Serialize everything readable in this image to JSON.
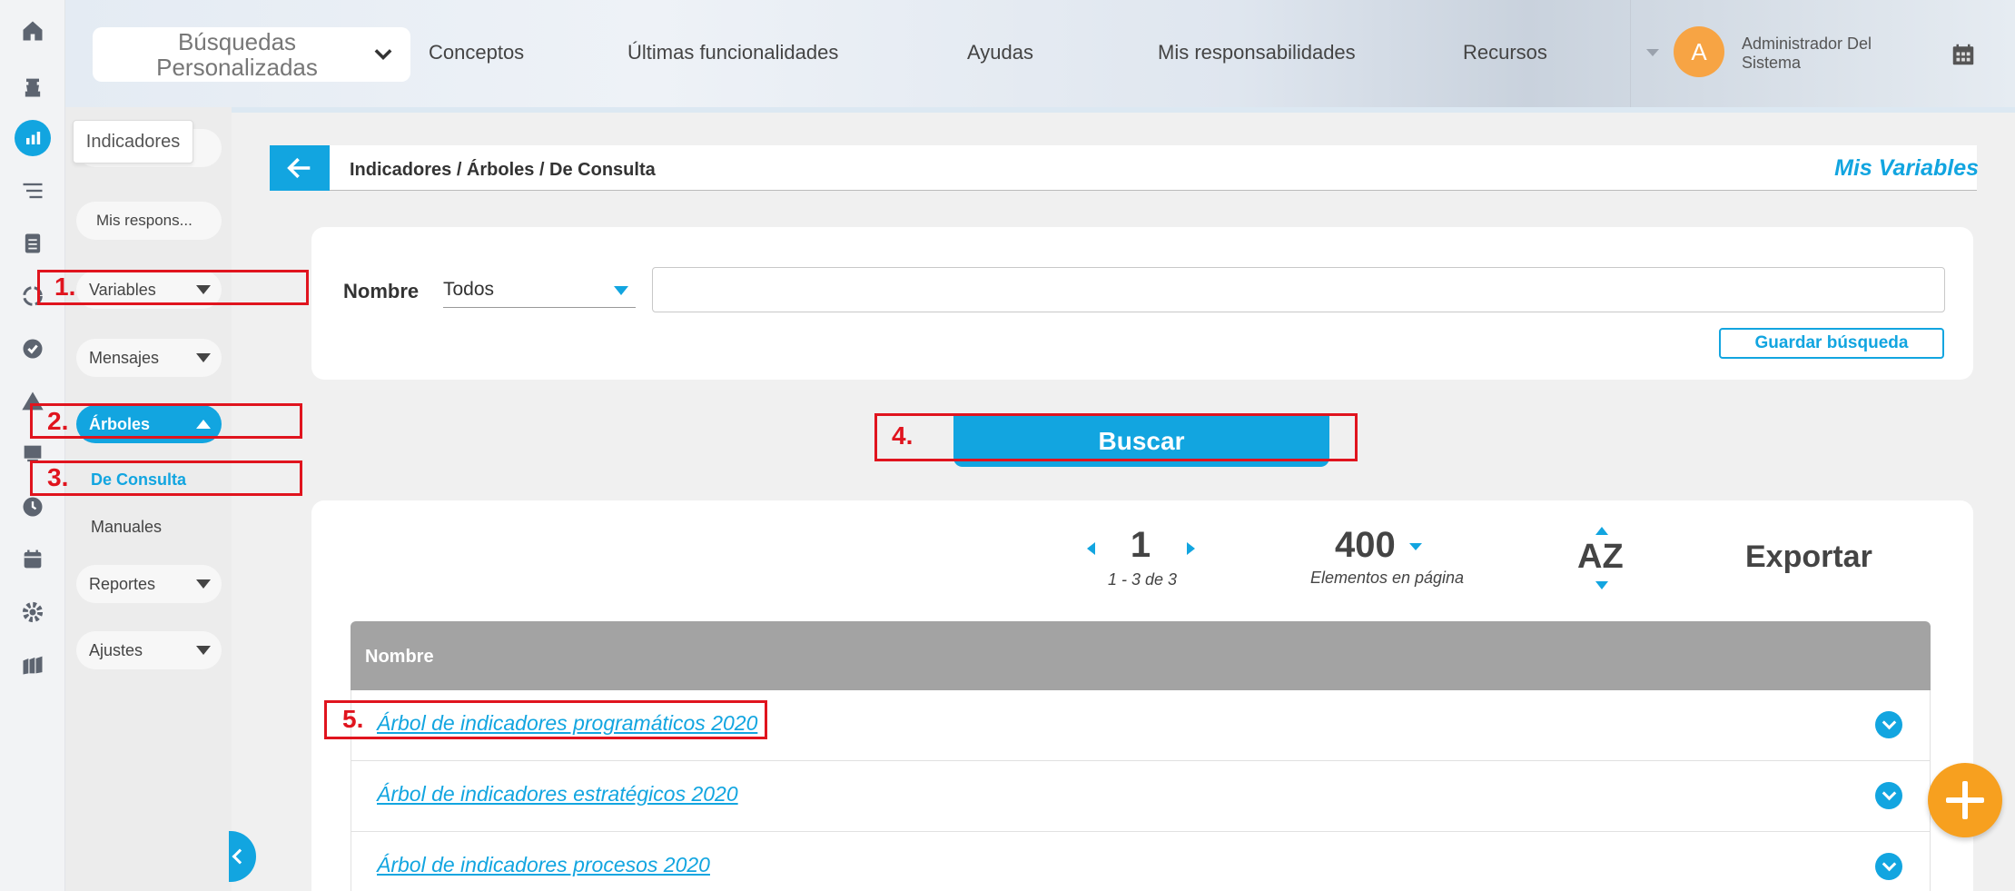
{
  "header": {
    "search_label": "Búsquedas Personalizadas",
    "nav": [
      "Conceptos",
      "Últimas funcionalidades",
      "Ayudas",
      "Mis responsabilidades",
      "Recursos"
    ],
    "user_initial": "A",
    "user_name": "Administrador Del Sistema"
  },
  "sidebar": {
    "tooltip": "Indicadores",
    "items": {
      "mis_responsabilidades": "Mis respons...",
      "variables": "Variables",
      "mensajes": "Mensajes",
      "arboles": "Árboles",
      "de_consulta": "De Consulta",
      "manuales": "Manuales",
      "reportes": "Reportes",
      "ajustes": "Ajustes"
    }
  },
  "main": {
    "breadcrumb": "Indicadores / Árboles / De Consulta",
    "section_title": "Mis Variables",
    "filter": {
      "label": "Nombre",
      "select_value": "Todos",
      "input_value": "",
      "save_button": "Guardar búsqueda"
    },
    "search_button": "Buscar",
    "pagination": {
      "page": "1",
      "range": "1 - 3 de 3",
      "per_page": "400",
      "per_page_label": "Elementos en página",
      "sort": "AZ",
      "export": "Exportar"
    },
    "table": {
      "header": "Nombre",
      "rows": [
        "Árbol de indicadores programáticos 2020",
        "Árbol de indicadores estratégicos 2020",
        "Árbol de indicadores procesos 2020"
      ]
    }
  },
  "annotations": [
    "1.",
    "2.",
    "3.",
    "4.",
    "5."
  ],
  "colors": {
    "accent": "#12a5e0",
    "fab": "#f7a01f",
    "annotation": "#e0141e",
    "avatar": "#f7a444"
  }
}
